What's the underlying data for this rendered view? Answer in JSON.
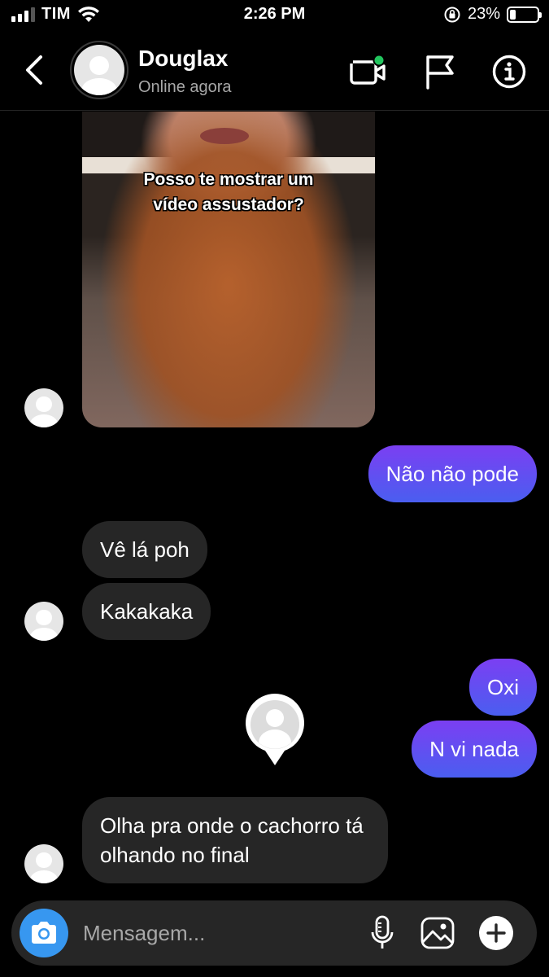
{
  "status_bar": {
    "carrier": "TIM",
    "time": "2:26 PM",
    "battery_percent": "23%",
    "battery_level": 0.23
  },
  "header": {
    "contact_name": "Douglax",
    "contact_status": "Online agora",
    "icons": [
      "back-chevron-icon",
      "video-call-icon",
      "flag-icon",
      "info-icon"
    ]
  },
  "messages": [
    {
      "from": "contact",
      "type": "video",
      "caption_line1": "Posso te mostrar um",
      "caption_line2": "vídeo assustador?"
    },
    {
      "from": "me",
      "text": "Não não pode"
    },
    {
      "from": "contact",
      "text": "Vê lá poh"
    },
    {
      "from": "contact",
      "text": "Kakakaka"
    },
    {
      "from": "me",
      "text": "Oxi"
    },
    {
      "from": "me",
      "text": "N vi nada"
    },
    {
      "from": "contact",
      "text_line1": "Olha pra onde o cachorro tá",
      "text_line2": "olhando no final"
    }
  ],
  "composer": {
    "placeholder": "Mensagem...",
    "icons": [
      "camera-icon",
      "microphone-icon",
      "gallery-icon",
      "plus-icon"
    ]
  },
  "colors": {
    "background": "#000000",
    "incoming_bubble": "#262626",
    "outgoing_gradient_start": "#7b3ff2",
    "outgoing_gradient_end": "#4a5ef0",
    "camera_button": "#3797f0",
    "online_dot": "#22c55e"
  }
}
